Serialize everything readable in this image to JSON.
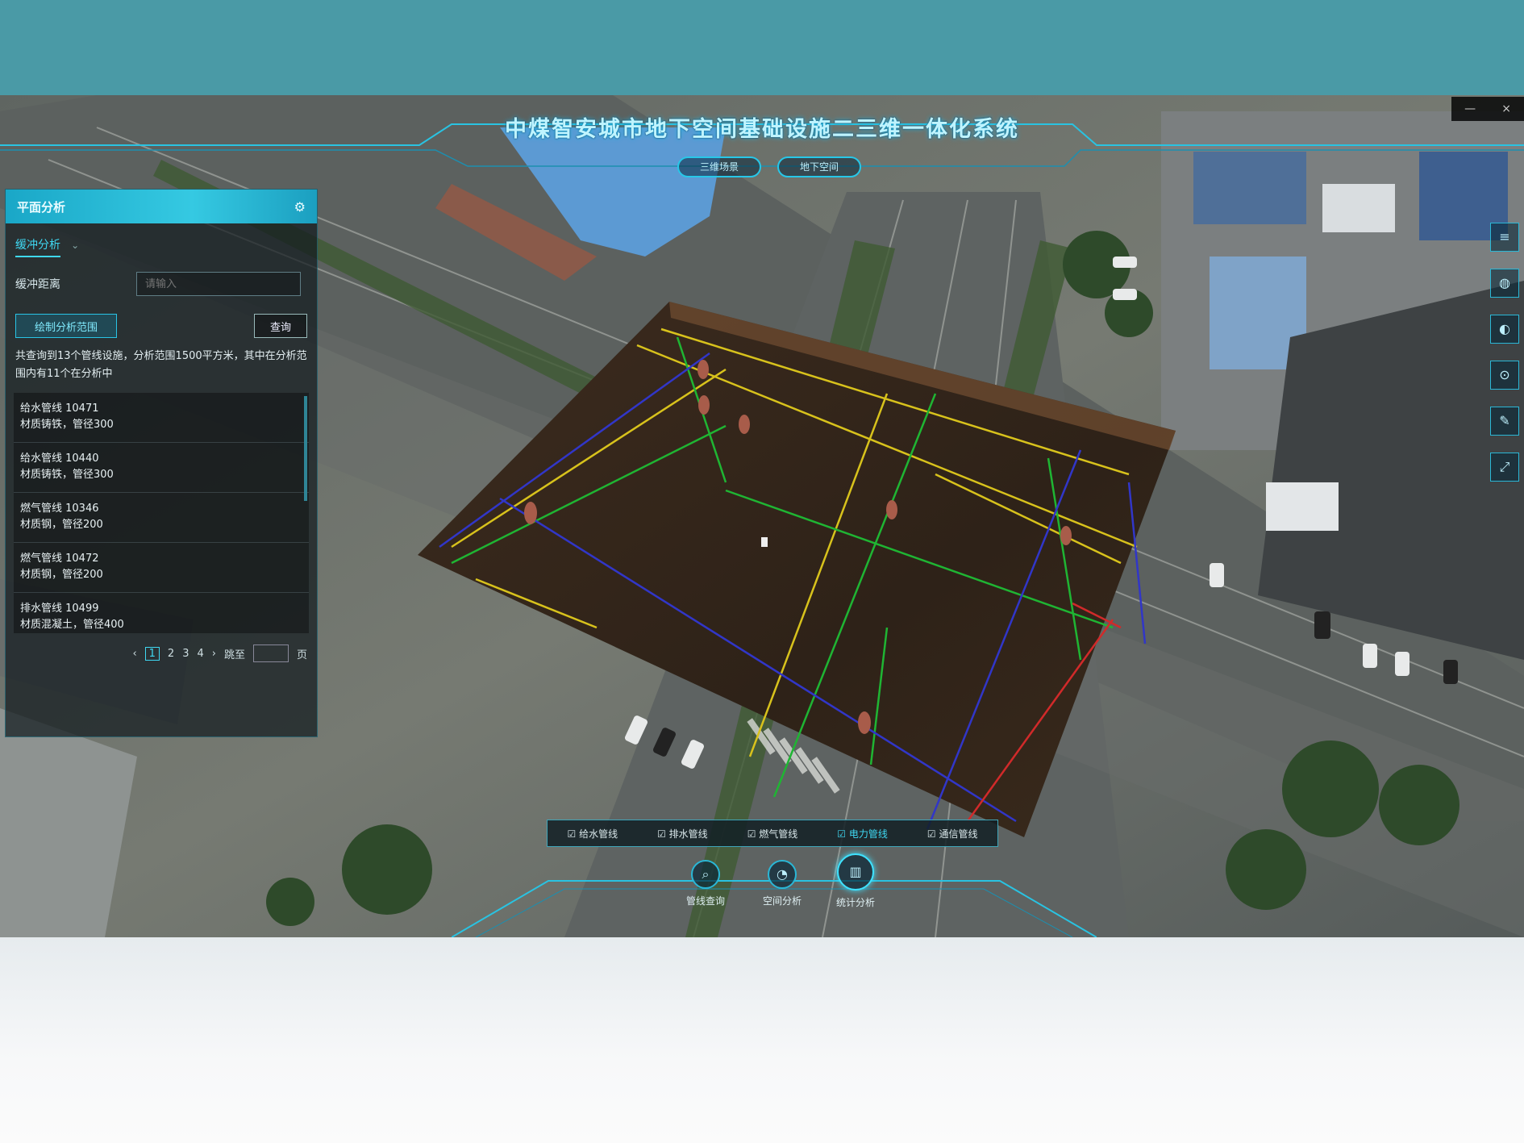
{
  "window": {
    "title": "中煤智安城市地下空间基础设施二三维一体化系统"
  },
  "header": {
    "pills": [
      "三维场景",
      "地下空间"
    ]
  },
  "window_controls": {
    "minimize": "—",
    "close": "×"
  },
  "panel": {
    "title": "平面分析",
    "tool_icon": "settings-icon",
    "tab": "缓冲分析",
    "field_label": "缓冲距离",
    "field_placeholder": "请输入",
    "draw_button": "绘制分析范围",
    "query_button": "查询",
    "summary": "共查询到13个管线设施，分析范围1500平方米，其中在分析范围内有11个在分析中",
    "items": [
      {
        "name": "给水管线 10471",
        "desc": "材质铸铁，管径300"
      },
      {
        "name": "给水管线 10440",
        "desc": "材质铸铁，管径300"
      },
      {
        "name": "燃气管线 10346",
        "desc": "材质钢，管径200"
      },
      {
        "name": "燃气管线 10472",
        "desc": "材质钢，管径200"
      },
      {
        "name": "排水管线 10499",
        "desc": "材质混凝土，管径400"
      }
    ],
    "pager": {
      "prev": "‹",
      "pages": [
        "1",
        "2",
        "3",
        "4"
      ],
      "next": "›",
      "goto": "跳至",
      "unit": "页"
    }
  },
  "right_tools": [
    "layers-icon",
    "globe-icon",
    "compass-icon",
    "locate-icon",
    "measure-icon",
    "fullscreen-icon"
  ],
  "layer_bar": {
    "items": [
      {
        "label": "给水管线",
        "active": false
      },
      {
        "label": "排水管线",
        "active": false
      },
      {
        "label": "燃气管线",
        "active": false
      },
      {
        "label": "电力管线",
        "active": true
      },
      {
        "label": "通信管线",
        "active": false
      }
    ]
  },
  "dock": [
    {
      "label": "管线查询",
      "icon": "search-icon",
      "active": false
    },
    {
      "label": "空间分析",
      "icon": "analysis-icon",
      "active": false
    },
    {
      "label": "统计分析",
      "icon": "chart-icon",
      "active": true
    }
  ]
}
